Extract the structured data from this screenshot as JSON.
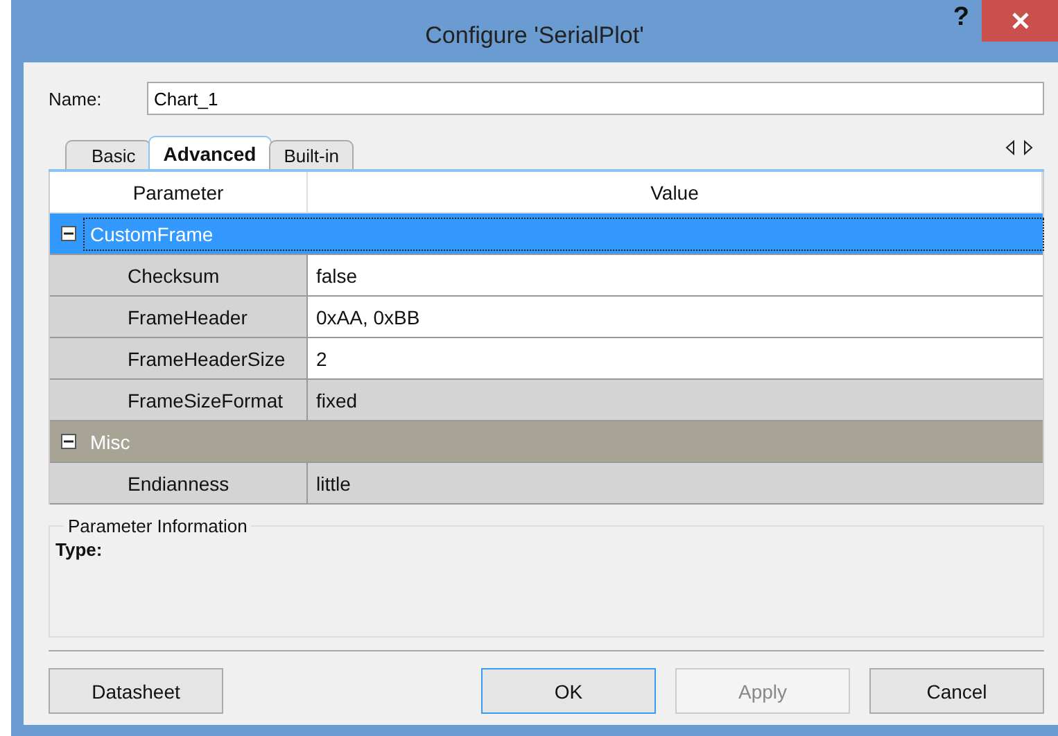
{
  "window": {
    "title": "Configure 'SerialPlot'",
    "help": "?"
  },
  "name_field": {
    "label": "Name:",
    "value": "Chart_1"
  },
  "tabs": [
    {
      "label": "Basic",
      "selected": false
    },
    {
      "label": "Advanced",
      "selected": true
    },
    {
      "label": "Built-in",
      "selected": false
    }
  ],
  "grid": {
    "columns": [
      "Parameter",
      "Value"
    ],
    "categories": [
      {
        "name": "CustomFrame",
        "selected": true,
        "expanded": true,
        "children": [
          {
            "name": "Checksum",
            "value": "false",
            "readonly": false
          },
          {
            "name": "FrameHeader",
            "value": "0xAA, 0xBB",
            "readonly": false
          },
          {
            "name": "FrameHeaderSize",
            "value": "2",
            "readonly": false
          },
          {
            "name": "FrameSizeFormat",
            "value": "fixed",
            "readonly": true
          }
        ]
      },
      {
        "name": "Misc",
        "selected": false,
        "expanded": true,
        "children": [
          {
            "name": "Endianness",
            "value": "little",
            "readonly": true
          }
        ]
      }
    ]
  },
  "info": {
    "legend": "Parameter Information",
    "type_label": "Type:"
  },
  "buttons": [
    {
      "label": "Datasheet",
      "kind": "left",
      "disabled": false,
      "focused": false
    },
    {
      "label": "OK",
      "kind": "right",
      "disabled": false,
      "focused": true
    },
    {
      "label": "Apply",
      "kind": "right",
      "disabled": true,
      "focused": false
    },
    {
      "label": "Cancel",
      "kind": "right",
      "disabled": false,
      "focused": false
    }
  ]
}
